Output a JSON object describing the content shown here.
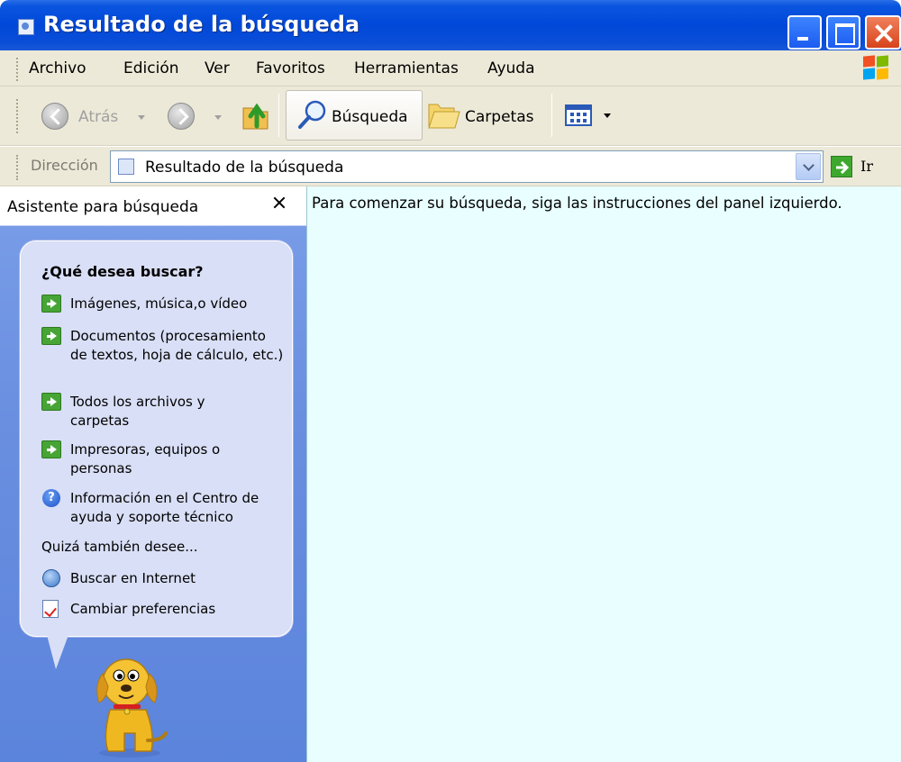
{
  "window": {
    "title": "Resultado de la búsqueda"
  },
  "menu": {
    "items": [
      "Archivo",
      "Edición",
      "Ver",
      "Favoritos",
      "Herramientas",
      "Ayuda"
    ]
  },
  "toolbar": {
    "back_label": "Atrás",
    "search_label": "Búsqueda",
    "folders_label": "Carpetas"
  },
  "address": {
    "label": "Dirección",
    "value": "Resultado de la búsqueda",
    "go_label": "Ir"
  },
  "search_pane": {
    "title": "Asistente para búsqueda",
    "heading": "¿Qué desea buscar?",
    "options": [
      "Imágenes, música,o vídeo",
      "Documentos (procesamiento de textos, hoja de cálculo, etc.)",
      "Todos los archivos y carpetas",
      "Impresoras, equipos o personas",
      "Información en el Centro de ayuda y soporte técnico"
    ],
    "also_label": "Quizá también desee...",
    "extra_options": [
      "Buscar en Internet",
      "Cambiar preferencias"
    ]
  },
  "results": {
    "instruction": "Para comenzar su búsqueda, siga las instrucciones del panel izquierdo."
  }
}
